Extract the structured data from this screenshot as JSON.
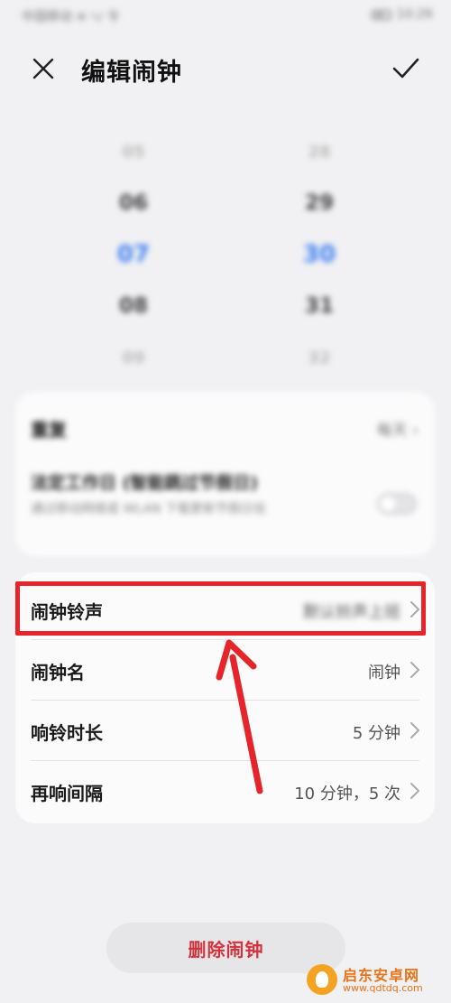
{
  "status_bar": {
    "carrier": "中国移动 ≋ ᵞ₄ᴵ 令",
    "time": "10:26"
  },
  "header": {
    "title": "编辑闹钟"
  },
  "picker": {
    "hours": [
      "05",
      "06",
      "07",
      "08",
      "09"
    ],
    "minutes": [
      "28",
      "29",
      "30",
      "31",
      "32"
    ]
  },
  "settings_top": {
    "repeat_label": "重复",
    "repeat_value": "每天 ›",
    "workday_title": "法定工作日 (智能跳过节假日)",
    "workday_sub": "通过移动网络或 WLAN 下载更新节假日信"
  },
  "settings": {
    "ringtone_label": "闹钟铃声",
    "ringtone_value": "默认铃声上班",
    "name_label": "闹钟名",
    "name_value": "闹钟",
    "duration_label": "响铃时长",
    "duration_value": "5 分钟",
    "snooze_label": "再响间隔",
    "snooze_value": "10 分钟，5 次"
  },
  "delete_label": "删除闹钟",
  "watermark": {
    "title": "启东安卓网",
    "url": "www.qdtdq.com"
  },
  "colors": {
    "accent_blue": "#3d7ff0",
    "highlight_red": "#e5252a",
    "delete_red": "#d2333a",
    "background": "#f1f1f3"
  }
}
